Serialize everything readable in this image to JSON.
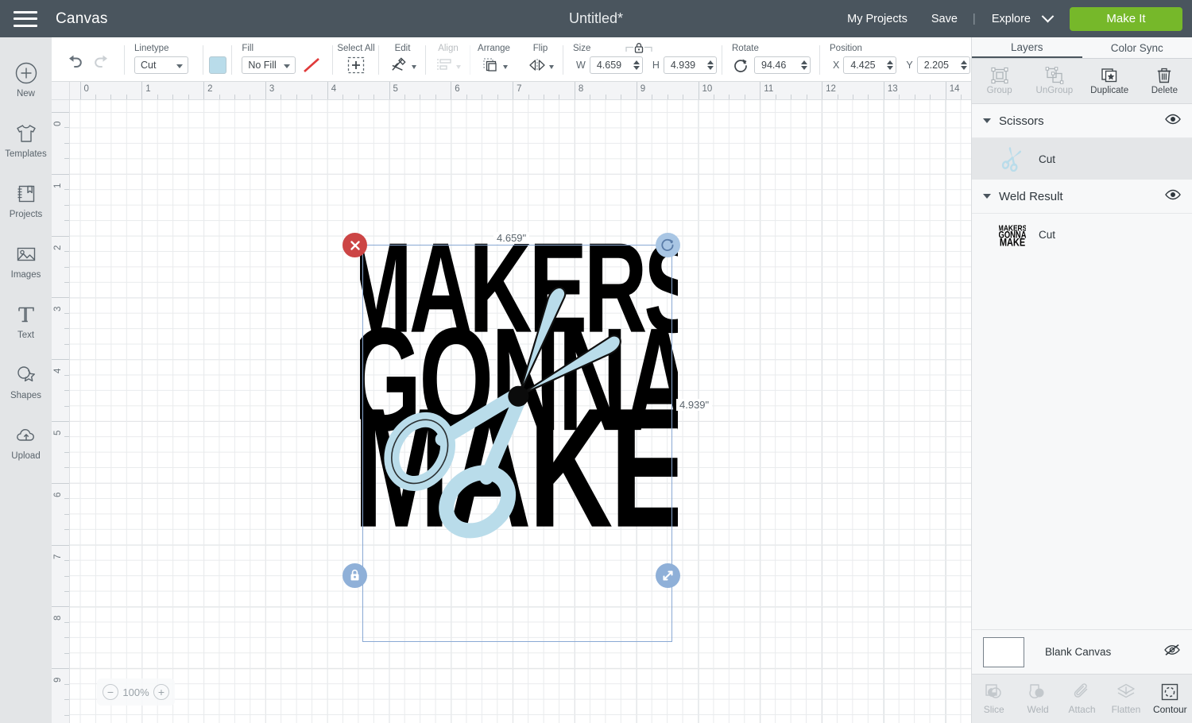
{
  "topbar": {
    "menu_icon": "hamburger-icon",
    "canvas_label": "Canvas",
    "document_title": "Untitled*",
    "my_projects": "My Projects",
    "save": "Save",
    "separator": "|",
    "explore": "Explore",
    "make_it": "Make It",
    "make_it_color": "#76b82a",
    "background": "#4a555e"
  },
  "rail": {
    "items": [
      {
        "label": "New",
        "icon": "plus-circle-icon"
      },
      {
        "label": "Templates",
        "icon": "tshirt-icon"
      },
      {
        "label": "Projects",
        "icon": "notebook-icon"
      },
      {
        "label": "Images",
        "icon": "image-icon"
      },
      {
        "label": "Text",
        "icon": "text-icon"
      },
      {
        "label": "Shapes",
        "icon": "shapes-icon"
      },
      {
        "label": "Upload",
        "icon": "cloud-upload-icon"
      }
    ]
  },
  "toolbar": {
    "undo": "undo-icon",
    "redo": "redo-icon",
    "linetype_label": "Linetype",
    "linetype_value": "Cut",
    "linetype_swatch": "#b9dcea",
    "fill_label": "Fill",
    "fill_value": "No Fill",
    "fill_icon": "no-fill-slash-icon",
    "select_all_label": "Select All",
    "select_all_icon": "select-all-icon",
    "edit_label": "Edit",
    "edit_icon": "edit-scissors-icon",
    "align_label": "Align",
    "align_icon": "align-icon",
    "arrange_label": "Arrange",
    "arrange_icon": "arrange-icon",
    "flip_label": "Flip",
    "flip_icon": "flip-icon",
    "size_label": "Size",
    "lock_icon": "lock-closed-icon",
    "width_label": "W",
    "width_value": "4.659",
    "height_label": "H",
    "height_value": "4.939",
    "rotate_label": "Rotate",
    "rotate_icon": "rotate-icon",
    "rotate_value": "94.46",
    "position_label": "Position",
    "x_label": "X",
    "x_value": "4.425",
    "y_label": "Y",
    "y_value": "2.205"
  },
  "canvas": {
    "ruler_h": [
      "0",
      "1",
      "2",
      "3",
      "4",
      "5",
      "6",
      "7",
      "8",
      "9",
      "10",
      "11",
      "12",
      "13",
      "14"
    ],
    "ruler_v": [
      "0",
      "1",
      "2",
      "3",
      "4",
      "5",
      "6",
      "7",
      "8",
      "9"
    ],
    "width_tag": "4.659\"",
    "height_tag": "4.939\"",
    "zoom_level": "100%",
    "zoom_out": "−",
    "zoom_in": "+",
    "handles": {
      "delete": "delete-x-icon",
      "rotate": "rotate-handle-icon",
      "lock": "lock-handle-icon",
      "resize": "resize-handle-icon"
    },
    "artwork": {
      "lines": [
        "MAKERS",
        "GONNA",
        "MAKE"
      ],
      "text_color": "#000000",
      "scissors_color": "#b9dcea",
      "scissors_stroke": "#1a1a1a"
    }
  },
  "right_panel": {
    "tabs": [
      {
        "label": "Layers",
        "active": true
      },
      {
        "label": "Color Sync",
        "active": false
      }
    ],
    "actions": [
      {
        "label": "Group",
        "icon": "group-icon",
        "enabled": false
      },
      {
        "label": "UnGroup",
        "icon": "ungroup-icon",
        "enabled": false
      },
      {
        "label": "Duplicate",
        "icon": "duplicate-icon",
        "enabled": true
      },
      {
        "label": "Delete",
        "icon": "trash-icon",
        "enabled": true
      }
    ],
    "groups": [
      {
        "name": "Scissors",
        "eye_icon": "eye-visible-icon",
        "layers": [
          {
            "name": "Cut",
            "thumb": "scissors-thumb",
            "selected": true
          }
        ]
      },
      {
        "name": "Weld Result",
        "eye_icon": "eye-visible-icon",
        "layers": [
          {
            "name": "Cut",
            "thumb": "makers-gonna-make-thumb",
            "selected": false
          }
        ]
      }
    ],
    "blank_canvas": {
      "label": "Blank Canvas",
      "eye_icon": "eye-hidden-icon"
    },
    "bottom_tools": [
      {
        "label": "Slice",
        "icon": "slice-icon",
        "enabled": false
      },
      {
        "label": "Weld",
        "icon": "weld-icon",
        "enabled": false
      },
      {
        "label": "Attach",
        "icon": "paperclip-icon",
        "enabled": false
      },
      {
        "label": "Flatten",
        "icon": "flatten-icon",
        "enabled": false
      },
      {
        "label": "Contour",
        "icon": "contour-icon",
        "enabled": true
      }
    ]
  }
}
